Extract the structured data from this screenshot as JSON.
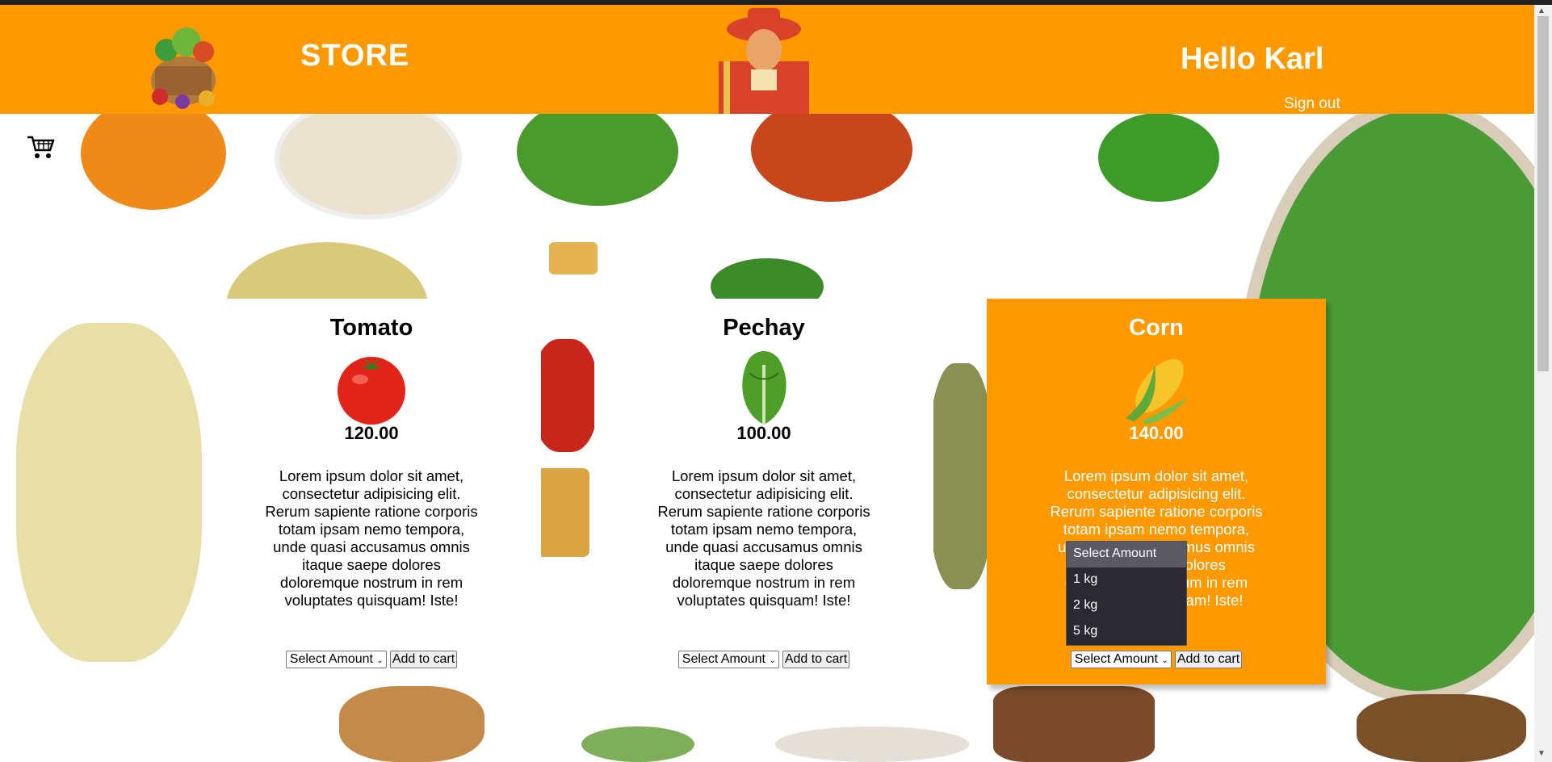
{
  "header": {
    "store_title": "STORE",
    "greeting": "Hello Karl",
    "signout_label": "Sign out",
    "brand_color": "#fe9a00"
  },
  "products": [
    {
      "name": "Tomato",
      "price": "120.00",
      "description": "Lorem ipsum dolor sit amet, consectetur adipisicing elit. Rerum sapiente ratione corporis totam ipsam nemo tempora, unde quasi accusamus omnis itaque saepe dolores doloremque nostrum in rem voluptates quisquam! Iste!",
      "select_label": "Select Amount",
      "button_label": "Add to cart"
    },
    {
      "name": "Pechay",
      "price": "100.00",
      "description": "Lorem ipsum dolor sit amet, consectetur adipisicing elit. Rerum sapiente ratione corporis totam ipsam nemo tempora, unde quasi accusamus omnis itaque saepe dolores doloremque nostrum in rem voluptates quisquam! Iste!",
      "select_label": "Select Amount",
      "button_label": "Add to cart"
    },
    {
      "name": "Corn",
      "price": "140.00",
      "description": "Lorem ipsum dolor sit amet, consectetur adipisicing elit. Rerum sapiente ratione corporis totam ipsam nemo tempora, unde quasi accusamus omnis itaque saepe dolores doloremque nostrum in rem voluptates quisquam! Iste!",
      "select_label": "Select Amount",
      "button_label": "Add to cart"
    }
  ],
  "amount_dropdown": {
    "options": [
      "Select Amount",
      "1 kg",
      "2 kg",
      "5 kg"
    ]
  },
  "icons": {
    "cart": "cart-icon",
    "store_logo": "vegetable-basket-logo",
    "brand_logo": "farmer-logo"
  }
}
